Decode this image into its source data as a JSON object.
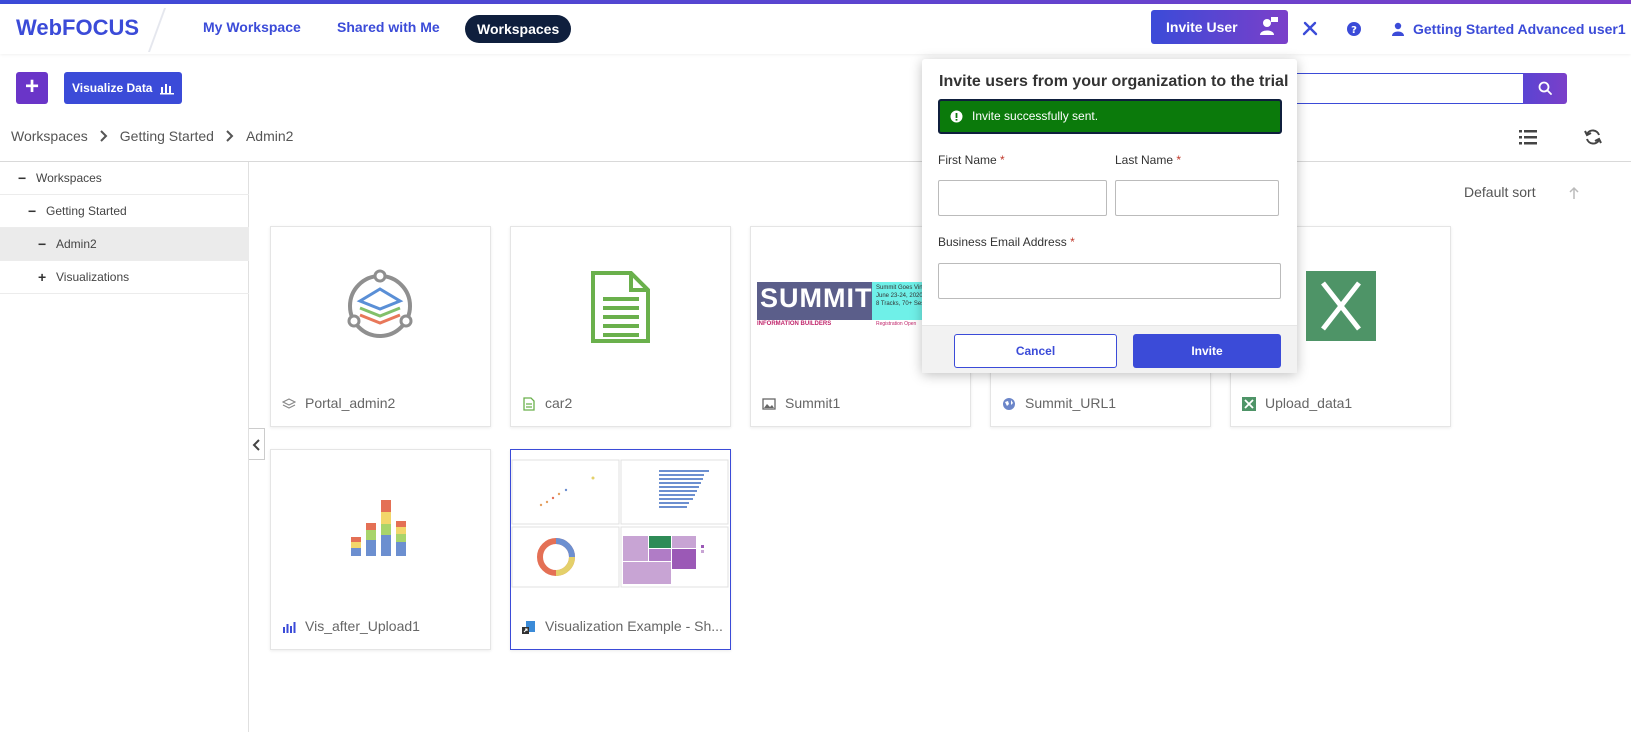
{
  "app": {
    "logo": "WebFOCUS"
  },
  "nav": {
    "my_workspace": "My Workspace",
    "shared_with_me": "Shared with Me",
    "workspaces": "Workspaces"
  },
  "header": {
    "invite_user": "Invite User",
    "user_name": "Getting Started Advanced user1"
  },
  "toolbar": {
    "plus": "+",
    "visualize_data": "Visualize Data"
  },
  "breadcrumb": [
    "Workspaces",
    "Getting Started",
    "Admin2"
  ],
  "tree": {
    "items": [
      {
        "label": "Workspaces",
        "mark": "−"
      },
      {
        "label": "Getting Started",
        "mark": "−"
      },
      {
        "label": "Admin2",
        "mark": "−"
      },
      {
        "label": "Visualizations",
        "mark": "+"
      }
    ]
  },
  "sort": {
    "label": "Default sort"
  },
  "cards": [
    {
      "label": "Portal_admin2",
      "icon": "portal-icon"
    },
    {
      "label": "car2",
      "icon": "document-icon"
    },
    {
      "label": "Summit1",
      "icon": "image-icon"
    },
    {
      "label": "Summit_URL1",
      "icon": "globe-icon"
    },
    {
      "label": "Upload_data1",
      "icon": "excel-icon"
    },
    {
      "label": "Vis_after_Upload1",
      "icon": "chart-icon"
    },
    {
      "label": "Visualization Example - Sh...",
      "icon": "shortcut-icon"
    }
  ],
  "summit_thumb": {
    "logo": "SUMMIT",
    "sub": "INFORMATION BUILDERS",
    "right_lines": [
      "Summit Goes Virtual",
      "June 23-24, 2020",
      "8 Tracks, 70+ Ses"
    ],
    "reg": "Registration Open"
  },
  "modal": {
    "title": "Invite users from your organization to the trial",
    "success": "Invite successfully sent.",
    "first_name_label": "First Name",
    "last_name_label": "Last Name",
    "email_label": "Business Email Address",
    "required_mark": "*",
    "first_name_value": "",
    "last_name_value": "",
    "email_value": "",
    "cancel": "Cancel",
    "invite": "Invite"
  },
  "colors": {
    "brand": "#3b4bd8",
    "accent": "#7b3fc9",
    "success": "#0b7a0b",
    "dark": "#0f1f3d"
  }
}
